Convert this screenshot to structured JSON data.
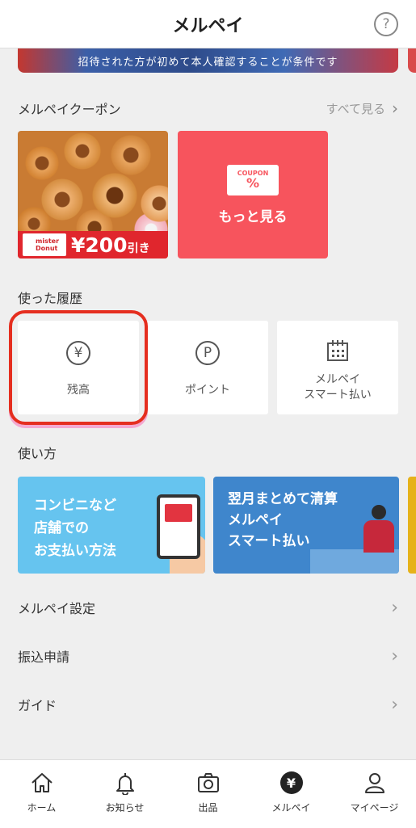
{
  "header": {
    "title": "メルペイ",
    "help_label": "?"
  },
  "banner": {
    "text": "招待された方が初めて本人確認することが条件です"
  },
  "coupons": {
    "title": "メルペイクーポン",
    "see_all": "すべて見る",
    "items": [
      {
        "brand": "mister Donut",
        "price": "¥200",
        "suffix": "引き"
      }
    ],
    "more": {
      "ticket_top": "COUPON",
      "ticket_symbol": "%",
      "label": "もっと見る"
    }
  },
  "history": {
    "title": "使った履歴",
    "items": [
      {
        "label": "残高",
        "icon": "¥"
      },
      {
        "label": "ポイント",
        "icon": "P"
      },
      {
        "label_line1": "メルペイ",
        "label_line2": "スマート払い",
        "icon": "calendar"
      }
    ]
  },
  "howto": {
    "title": "使い方",
    "cards": [
      {
        "line1": "コンビニなど",
        "line2": "店舗での",
        "line3": "お支払い方法",
        "color": "#66c4ef"
      },
      {
        "line1": "翌月まとめて清算",
        "line2": "メルペイ",
        "line3": "スマート払い",
        "color": "#3f86cc"
      }
    ]
  },
  "menu": [
    {
      "label": "メルペイ設定"
    },
    {
      "label": "振込申請"
    },
    {
      "label": "ガイド"
    }
  ],
  "tabbar": [
    {
      "label": "ホーム",
      "icon": "home-icon"
    },
    {
      "label": "お知らせ",
      "icon": "bell-icon"
    },
    {
      "label": "出品",
      "icon": "camera-icon"
    },
    {
      "label": "メルペイ",
      "icon": "yen-icon",
      "active": true
    },
    {
      "label": "マイページ",
      "icon": "person-icon"
    }
  ],
  "colors": {
    "accent": "#f7545d",
    "highlight": "#e52e1f",
    "coupon_red": "#e0262d"
  }
}
